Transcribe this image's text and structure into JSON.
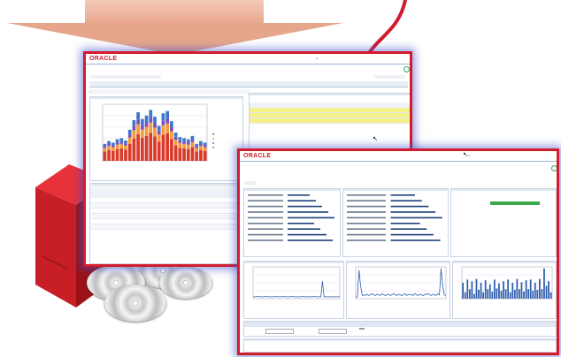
{
  "window1": {
    "logo": "ORACLE",
    "title": "",
    "header_links": [
      "",
      "",
      ""
    ],
    "refresh_text": "",
    "tabs": [
      "",
      "",
      "",
      "",
      "",
      "",
      ""
    ],
    "chart": {
      "title": "",
      "legend": [
        "",
        "",
        "",
        ""
      ]
    },
    "change_panel": {
      "title": "",
      "section": "",
      "columns": [
        "",
        "",
        ""
      ],
      "rows": [
        [
          "",
          "",
          ""
        ],
        [
          "",
          "",
          ""
        ],
        [
          "",
          "",
          ""
        ]
      ]
    },
    "details": {
      "title": "",
      "columns": [
        "",
        "",
        "",
        ""
      ],
      "rows": [
        "",
        "",
        "",
        "",
        "",
        ""
      ]
    }
  },
  "window2": {
    "logo": "ORACLE",
    "title": "",
    "breadcrumb": "",
    "header_links": [
      "",
      "",
      ""
    ],
    "refresh_text": "",
    "sections": {
      "general": "",
      "configuration": "",
      "availability": ""
    },
    "availability_pct": 100,
    "availability_label": "",
    "availability_caption": "",
    "charts": [
      {
        "title": "",
        "caption": "",
        "values": [
          0.06,
          0.06,
          0.06,
          0.07,
          0.06,
          0.06,
          0.06,
          0.06,
          0.07,
          0.06,
          0.06,
          0.06,
          0.06,
          0.06,
          0.07,
          0.06,
          0.06,
          0.06,
          0.06,
          0.07,
          0.06,
          0.06,
          0.06,
          0.06,
          0.06,
          0.07,
          0.06,
          0.06,
          0.06,
          0.06,
          0.06,
          0.06,
          0.07,
          0.06,
          0.06,
          0.06,
          0.06,
          0.06,
          0.06,
          0.07,
          0.06,
          0.06,
          0.06,
          0.06,
          0.55,
          0.06,
          0.06,
          0.06,
          0.06,
          0.06,
          0.06,
          0.06,
          0.06,
          0.06,
          0.06,
          0.06
        ]
      },
      {
        "title": "",
        "caption": "",
        "values": [
          0.04,
          0.06,
          0.9,
          0.4,
          0.1,
          0.12,
          0.1,
          0.14,
          0.1,
          0.12,
          0.16,
          0.12,
          0.1,
          0.14,
          0.12,
          0.1,
          0.16,
          0.12,
          0.1,
          0.12,
          0.14,
          0.1,
          0.12,
          0.16,
          0.12,
          0.1,
          0.14,
          0.12,
          0.1,
          0.12,
          0.16,
          0.1,
          0.12,
          0.14,
          0.12,
          0.1,
          0.16,
          0.12,
          0.1,
          0.14,
          0.12,
          0.1,
          0.12,
          0.14,
          0.16,
          0.12,
          0.1,
          0.14,
          0.12,
          0.1,
          0.16,
          0.12,
          0.95,
          0.4,
          0.12,
          0.1
        ]
      },
      {
        "title": "",
        "caption": "",
        "values": [
          0.5,
          0.2,
          0.6,
          0.3,
          0.55,
          0.15,
          0.62,
          0.28,
          0.5,
          0.2,
          0.58,
          0.3,
          0.45,
          0.22,
          0.6,
          0.32,
          0.48,
          0.25,
          0.55,
          0.3,
          0.6,
          0.2,
          0.5,
          0.28,
          0.62,
          0.3,
          0.52,
          0.22,
          0.58,
          0.3,
          0.6,
          0.25,
          0.5,
          0.28,
          0.62,
          0.3,
          0.95,
          0.4,
          0.55,
          0.2
        ]
      }
    ],
    "bottom": {
      "title": "",
      "field1_label": "",
      "field2_label": "",
      "go_label": "",
      "trend_title": ""
    }
  }
}
